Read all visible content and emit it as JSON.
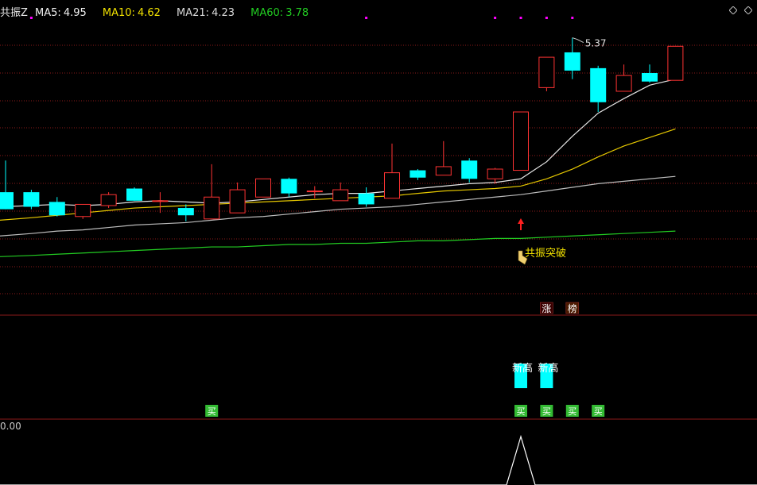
{
  "indicator": {
    "name": "共振Z",
    "ma": [
      {
        "label": "MA5:",
        "value": "4.95",
        "color": "#f0f0f0"
      },
      {
        "label": "MA10:",
        "value": "4.62",
        "color": "#f0e000"
      },
      {
        "label": "MA21:",
        "value": "4.23",
        "color": "#d8d8d8"
      },
      {
        "label": "MA60:",
        "value": "3.78",
        "color": "#22cc22"
      }
    ]
  },
  "colors": {
    "up": "#ff3333",
    "down": "#00ffff",
    "grid": "#8b1a1a",
    "divider": "#8b1a1a",
    "ma5": "#e6e6e6",
    "ma10": "#e6c800",
    "ma21": "#bdbdbd",
    "ma60": "#22cc22",
    "signal": "#ff00ff"
  },
  "chart_data": {
    "type": "candlestick",
    "ylim": [
      3.2,
      5.55
    ],
    "high_label": "5.37",
    "candles": [
      {
        "o": 4.1,
        "h": 4.36,
        "l": 3.96,
        "c": 3.96
      },
      {
        "o": 4.1,
        "h": 4.12,
        "l": 3.96,
        "c": 3.98
      },
      {
        "o": 4.02,
        "h": 4.06,
        "l": 3.9,
        "c": 3.91
      },
      {
        "o": 3.9,
        "h": 3.98,
        "l": 3.88,
        "c": 4.0
      },
      {
        "o": 3.99,
        "h": 4.1,
        "l": 3.97,
        "c": 4.08
      },
      {
        "o": 4.13,
        "h": 4.14,
        "l": 4.03,
        "c": 4.03
      },
      {
        "o": 4.03,
        "h": 4.1,
        "l": 3.93,
        "c": 4.03
      },
      {
        "o": 3.97,
        "h": 4.0,
        "l": 3.86,
        "c": 3.91
      },
      {
        "o": 3.88,
        "h": 4.33,
        "l": 3.88,
        "c": 4.06
      },
      {
        "o": 3.93,
        "h": 4.18,
        "l": 3.93,
        "c": 4.12
      },
      {
        "o": 4.06,
        "h": 4.21,
        "l": 4.06,
        "c": 4.21
      },
      {
        "o": 4.21,
        "h": 4.22,
        "l": 4.06,
        "c": 4.09
      },
      {
        "o": 4.11,
        "h": 4.15,
        "l": 4.05,
        "c": 4.11
      },
      {
        "o": 4.03,
        "h": 4.18,
        "l": 4.03,
        "c": 4.12
      },
      {
        "o": 4.09,
        "h": 4.14,
        "l": 3.98,
        "c": 4.0
      },
      {
        "o": 4.05,
        "h": 4.5,
        "l": 4.05,
        "c": 4.26
      },
      {
        "o": 4.28,
        "h": 4.29,
        "l": 4.2,
        "c": 4.22
      },
      {
        "o": 4.24,
        "h": 4.52,
        "l": 4.24,
        "c": 4.31
      },
      {
        "o": 4.36,
        "h": 4.38,
        "l": 4.18,
        "c": 4.21
      },
      {
        "o": 4.21,
        "h": 4.3,
        "l": 4.17,
        "c": 4.29
      },
      {
        "o": 4.28,
        "h": 4.76,
        "l": 4.28,
        "c": 4.76
      },
      {
        "o": 4.96,
        "h": 5.21,
        "l": 4.93,
        "c": 5.21
      },
      {
        "o": 5.25,
        "h": 5.37,
        "l": 5.03,
        "c": 5.1
      },
      {
        "o": 5.12,
        "h": 5.14,
        "l": 4.76,
        "c": 4.84
      },
      {
        "o": 4.93,
        "h": 5.15,
        "l": 4.93,
        "c": 5.06
      },
      {
        "o": 5.08,
        "h": 5.15,
        "l": 5.0,
        "c": 5.01
      },
      {
        "o": 5.02,
        "h": 5.3,
        "l": 5.02,
        "c": 5.3
      }
    ],
    "ma5": [
      3.98,
      3.99,
      4.0,
      3.99,
      4.0,
      4.02,
      4.03,
      4.02,
      4.01,
      4.02,
      4.04,
      4.06,
      4.08,
      4.09,
      4.09,
      4.11,
      4.13,
      4.15,
      4.17,
      4.18,
      4.21,
      4.35,
      4.56,
      4.75,
      4.87,
      4.98,
      5.03
    ],
    "ma10": [
      3.87,
      3.89,
      3.91,
      3.93,
      3.95,
      3.97,
      3.98,
      3.99,
      4.0,
      4.01,
      4.02,
      4.03,
      4.04,
      4.05,
      4.06,
      4.07,
      4.09,
      4.11,
      4.12,
      4.13,
      4.15,
      4.21,
      4.29,
      4.39,
      4.48,
      4.55,
      4.62
    ],
    "ma21": [
      3.74,
      3.76,
      3.78,
      3.79,
      3.81,
      3.83,
      3.84,
      3.85,
      3.87,
      3.89,
      3.9,
      3.92,
      3.94,
      3.96,
      3.97,
      3.98,
      4.0,
      4.02,
      4.04,
      4.06,
      4.08,
      4.11,
      4.14,
      4.17,
      4.19,
      4.21,
      4.23
    ],
    "ma60": [
      3.57,
      3.58,
      3.59,
      3.6,
      3.61,
      3.62,
      3.63,
      3.64,
      3.65,
      3.65,
      3.66,
      3.67,
      3.67,
      3.68,
      3.68,
      3.69,
      3.7,
      3.7,
      3.71,
      3.72,
      3.72,
      3.73,
      3.74,
      3.75,
      3.76,
      3.77,
      3.78
    ],
    "signal_dots": [
      1,
      14,
      19,
      20,
      21,
      22
    ],
    "breakout_index": 20,
    "breakout_label": "共振突破",
    "tags": [
      {
        "index": 21,
        "text": "涨"
      },
      {
        "index": 22,
        "text": "榜"
      }
    ],
    "new_high": {
      "indices": [
        20,
        21
      ],
      "label": "新高"
    },
    "green_markers": {
      "indices": [
        8,
        20,
        21,
        22,
        23
      ],
      "text": "买"
    },
    "bottom_value": "0.00"
  }
}
